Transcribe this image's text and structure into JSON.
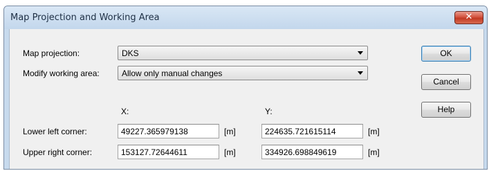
{
  "window": {
    "title": "Map Projection and Working Area",
    "close_glyph": "✕"
  },
  "projection": {
    "label": "Map projection:",
    "value": "DKS"
  },
  "working_area": {
    "label": "Modify working area:",
    "value": "Allow only manual changes"
  },
  "columns": {
    "x_header": "X:",
    "y_header": "Y:"
  },
  "lower_left": {
    "label": "Lower left corner:",
    "x": "49227.365979138",
    "y": "224635.721615114",
    "unit": "[m]"
  },
  "upper_right": {
    "label": "Upper right corner:",
    "x": "153127.72644611",
    "y": "334926.698849619",
    "unit": "[m]"
  },
  "buttons": {
    "ok": "OK",
    "cancel": "Cancel",
    "help": "Help"
  },
  "colors": {
    "title_bar": "#c7daed",
    "close_button": "#c8402a",
    "dialog_background": "#f0f0f0"
  }
}
